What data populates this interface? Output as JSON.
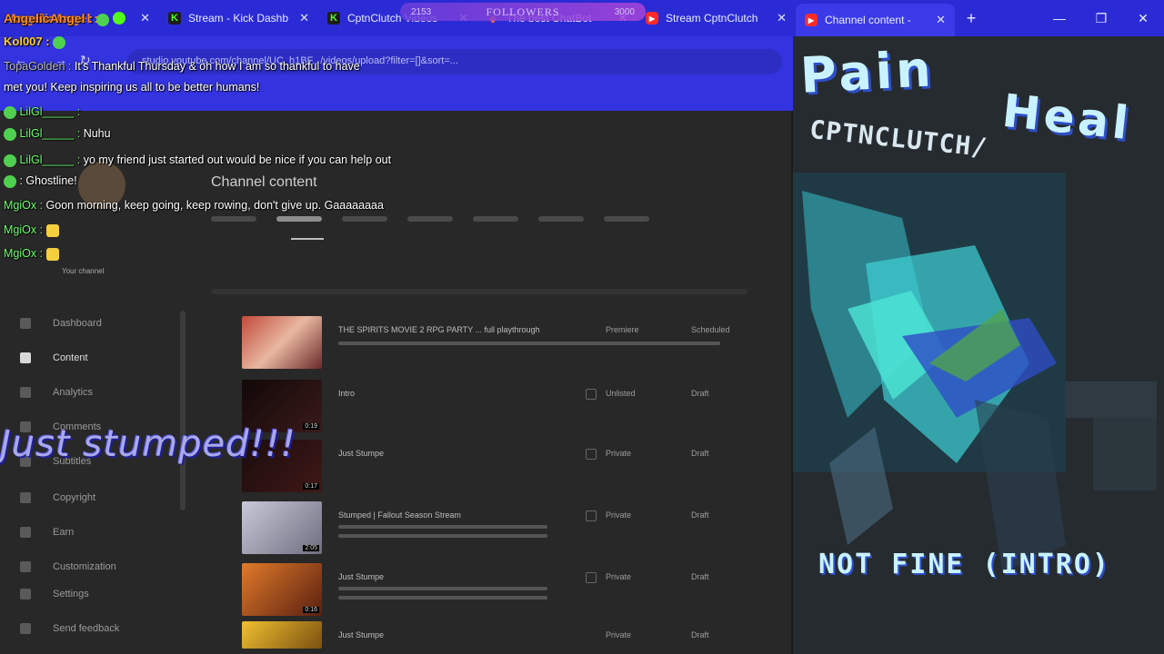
{
  "tabs": [
    {
      "label": "AngelicAngel :",
      "icon": "green-blob-icon",
      "active": false
    },
    {
      "label": "Stream - Kick Dashb",
      "icon": "kick-icon",
      "active": false
    },
    {
      "label": "CptnClutch Videos",
      "icon": "kick-icon",
      "active": false
    },
    {
      "label": "The best ChatBot",
      "icon": "chatbot-diamond-icon",
      "active": false
    },
    {
      "label": "Stream CptnClutch",
      "icon": "youtube-icon",
      "active": false
    },
    {
      "label": "Channel content -",
      "icon": "youtube-icon",
      "active": true
    }
  ],
  "new_tab_label": "+",
  "window_controls": {
    "minimize": "—",
    "restore": "❐",
    "close": "✕"
  },
  "followers_widget": {
    "label": "FOLLOWERS",
    "current": "2153",
    "goal": "3000"
  },
  "address_bar": {
    "url": "studio.youtube.com/channel/UC_h1BF.../videos/upload?filter=[]&sort=..."
  },
  "studio": {
    "page_title": "Channel content",
    "sidebar": [
      "Dashboard",
      "Content",
      "Analytics",
      "Comments",
      "Subtitles",
      "Copyright",
      "Earn",
      "Customization",
      "Settings",
      "Send feedback"
    ],
    "sidebar_selected": 1,
    "channel_label": "Your channel",
    "videos": [
      {
        "title": "THE SPIRITS MOVIE 2 RPG PARTY ... full playthrough",
        "visibility": "Premiere",
        "date": "Scheduled",
        "duration": "",
        "thumb": "#b83a34"
      },
      {
        "title": "Intro",
        "visibility": "Unlisted",
        "date": "Draft",
        "duration": "0:19",
        "thumb": "#2a1414"
      },
      {
        "title": "Just Stumpe",
        "visibility": "Private",
        "date": "Draft",
        "duration": "0:17",
        "thumb": "#241414"
      },
      {
        "title": "Stumped | Fallout Season Stream",
        "visibility": "Private",
        "date": "Draft",
        "duration": "2:05",
        "thumb": "#8e8e9e"
      },
      {
        "title": "Just Stumpe",
        "visibility": "Private",
        "date": "Draft",
        "duration": "0:16",
        "thumb": "#c4551f"
      },
      {
        "title": "Just Stumpe",
        "visibility": "Private",
        "date": "Draft",
        "duration": "",
        "thumb": "#d9a324"
      }
    ]
  },
  "chat": {
    "lines": [
      {
        "user": "AngelicAngel :",
        "text": ""
      },
      {
        "user": "Kol007 :",
        "text": ""
      },
      {
        "user": "TopaGolden :",
        "text": "It's Thankful Thursday & oh how I am so thankful to have"
      },
      {
        "user": "",
        "text": "met you! Keep inspiring us all to be better humans!"
      },
      {
        "user": "LilGl_____ :",
        "text": ""
      },
      {
        "user": "LilGl_____ :",
        "text": "Nuhu"
      },
      {
        "user": "LilGl_____ :",
        "text": "yo my friend just started out would be nice if you can help out"
      },
      {
        "user": "",
        "text": ": Ghostline!"
      },
      {
        "user": "MgiOx :",
        "text": "Goon morning, keep going, keep rowing, don't give up. Gaaaaaaaa"
      },
      {
        "user": "MgiOx :",
        "text": ""
      },
      {
        "user": "MgiOx :",
        "text": ""
      }
    ]
  },
  "overlay_text": "Just stumped!!!",
  "art": {
    "title_left": "Pain",
    "title_right": "Heal",
    "subtitle": "CPTNCLUTCH/",
    "bottom": "NOT FINE (INTRO)",
    "colors": {
      "accent": "#2e4ec5",
      "glow": "#4ee6d6"
    }
  },
  "theme": {
    "browser": "#2b2bd6",
    "studio_bg": "#282828"
  }
}
